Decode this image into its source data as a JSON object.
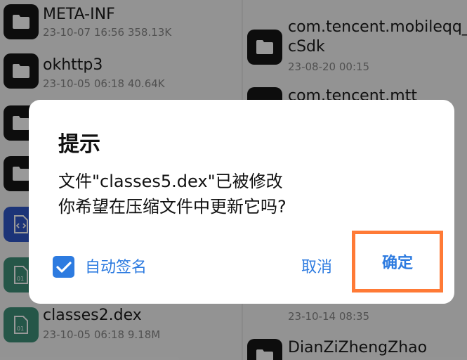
{
  "left_list": [
    {
      "name": "META-INF",
      "meta": "23-10-07 16:56  358.13K",
      "icon": "folder-icon"
    },
    {
      "name": "okhttp3",
      "meta": "23-10-05 06:18  40.64K",
      "icon": "folder-icon"
    },
    {
      "name": "",
      "meta": "",
      "icon": "folder-icon"
    },
    {
      "name": "",
      "meta": "",
      "icon": "folder-icon"
    },
    {
      "name": "",
      "meta": "",
      "icon": "code-file-icon"
    },
    {
      "name": "",
      "meta": "",
      "icon": "dex-file-icon"
    },
    {
      "name": "classes2.dex",
      "meta": "23-10-05 06:18  9.18M",
      "icon": "dex-file-icon"
    }
  ],
  "right_list": [
    {
      "name_line1": "com.tencent.mobileqq_",
      "name_line2": "cSdk",
      "meta": "23-08-20 00:15",
      "icon": "folder-icon"
    },
    {
      "name_line1": "com.tencent.mtt",
      "meta": "",
      "icon": "folder-icon"
    },
    {
      "name_line1": "",
      "meta": "23-10-14 08:35",
      "icon": ""
    },
    {
      "name_line1": "DianZiZhengZhao",
      "meta": "",
      "icon": "folder-icon"
    }
  ],
  "dialog": {
    "title": "提示",
    "message_line1": "文件\"classes5.dex\"已被修改",
    "message_line2": "你希望在压缩文件中更新它吗?",
    "checkbox_label": "自动签名",
    "checkbox_checked": true,
    "cancel_label": "取消",
    "ok_label": "确定",
    "highlight_color": "#ff7a36",
    "accent_color": "#2d7be0"
  }
}
